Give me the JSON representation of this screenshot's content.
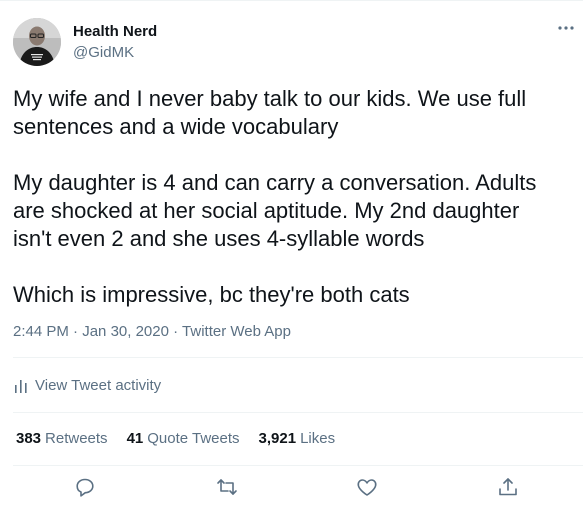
{
  "author": {
    "display_name": "Health Nerd",
    "handle": "@GidMK",
    "avatar_icon": "avatar-photo"
  },
  "tweet": {
    "paragraphs": [
      "My wife and I never baby talk to our kids. We use full\nsentences and a wide vocabulary",
      "My daughter is 4 and can carry a conversation. Adults\nare shocked at her social aptitude. My 2nd daughter\nisn't even 2 and she uses 4-syllable words",
      "Which is impressive, bc they're both cats"
    ],
    "time": "2:44 PM",
    "date": "Jan 30, 2020",
    "source": "Twitter Web App",
    "separator": "·"
  },
  "activity": {
    "label": "View Tweet activity",
    "icon": "bar-chart-icon"
  },
  "stats": {
    "retweets_count": "383",
    "retweets_label": "Retweets",
    "quotes_count": "41",
    "quotes_label": "Quote Tweets",
    "likes_count": "3,921",
    "likes_label": "Likes"
  },
  "actions": [
    "reply-icon",
    "retweet-icon",
    "like-icon",
    "share-icon"
  ],
  "colors": {
    "text": "#0f1419",
    "secondary": "#5b7083",
    "divider": "#eff3f4"
  }
}
